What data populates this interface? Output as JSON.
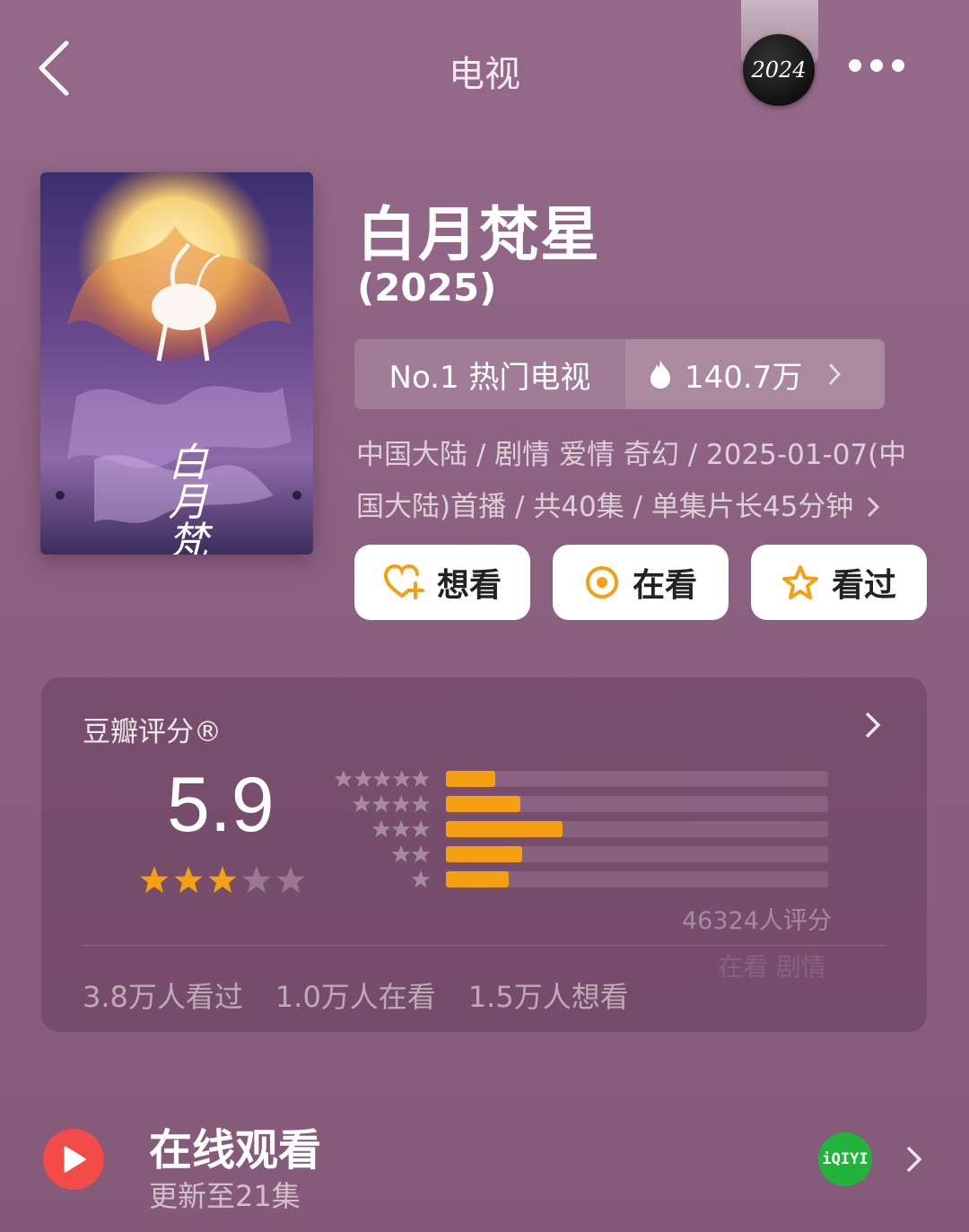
{
  "header": {
    "title": "电视",
    "badge_text": "2024",
    "back_icon": "chevron-left-icon",
    "more_icon": "more-dots-icon"
  },
  "show": {
    "title": "白月梵星",
    "year": "(2025)",
    "rank_label": "No.1 热门电视",
    "heat_value": "140.7万",
    "meta_line1": "中国大陆 / 剧情 爱情 奇幻 / 2025-01-07(中",
    "meta_line2": "国大陆)首播 / 共40集 / 单集片长45分钟",
    "poster_text": "白月梵星"
  },
  "actions": [
    {
      "label": "想看",
      "icon": "heart-plus-icon"
    },
    {
      "label": "在看",
      "icon": "target-circle-icon"
    },
    {
      "label": "看过",
      "icon": "star-outline-icon"
    }
  ],
  "rating": {
    "label": "豆瓣评分®",
    "score": "5.9",
    "score_stars": 3,
    "distribution": [
      {
        "stars": 5,
        "fraction": 0.13
      },
      {
        "stars": 4,
        "fraction": 0.195
      },
      {
        "stars": 3,
        "fraction": 0.305
      },
      {
        "stars": 2,
        "fraction": 0.2
      },
      {
        "stars": 1,
        "fraction": 0.165
      }
    ],
    "count": "46324人评分",
    "stats": [
      "3.8万人看过",
      "1.0万人在看",
      "1.5万人想看"
    ],
    "watermark": "在看 剧情"
  },
  "online": {
    "title": "在线观看",
    "subtitle": "更新至21集",
    "platform": "iQIYI"
  },
  "colors": {
    "accent": "#f5a012",
    "play": "#f24b48",
    "platform": "#22b33a"
  }
}
